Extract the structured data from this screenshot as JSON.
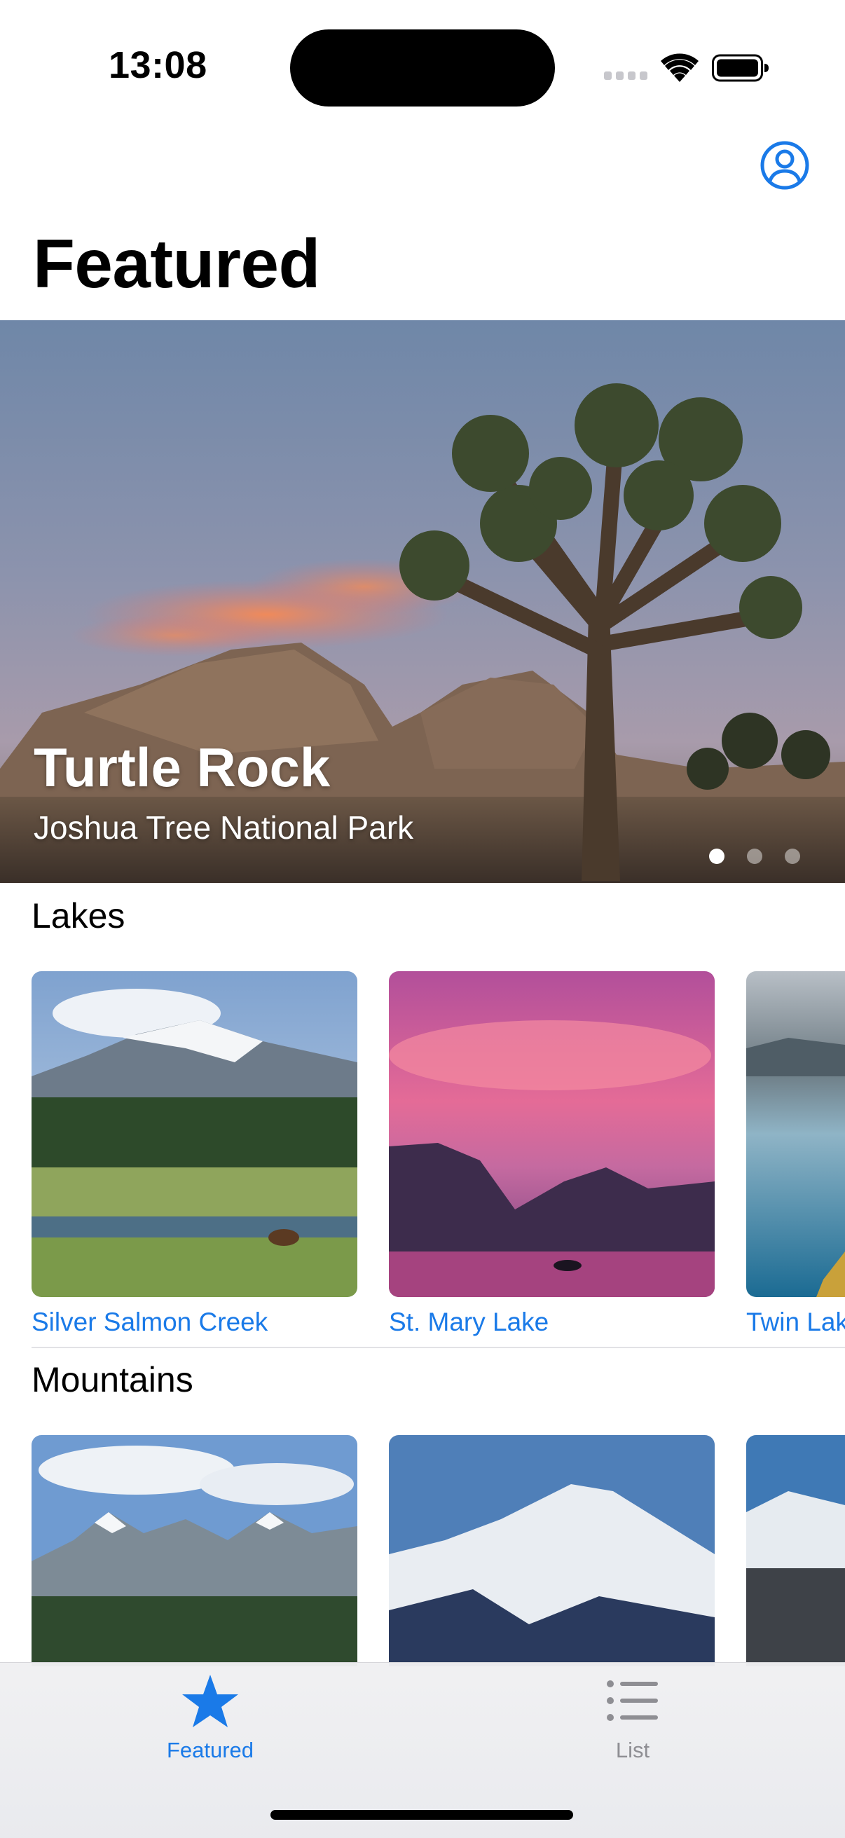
{
  "status_bar": {
    "time": "13:08"
  },
  "header": {
    "title": "Featured",
    "profile_icon": "person-circle-icon"
  },
  "hero": {
    "title": "Turtle Rock",
    "subtitle": "Joshua Tree National Park",
    "page_count": 3,
    "current_page": 1
  },
  "sections": [
    {
      "title": "Lakes",
      "items": [
        {
          "name": "Silver Salmon Creek"
        },
        {
          "name": "St. Mary Lake"
        },
        {
          "name": "Twin Lak"
        }
      ]
    },
    {
      "title": "Mountains",
      "items": []
    }
  ],
  "tab_bar": {
    "tabs": [
      {
        "label": "Featured",
        "icon": "star-icon",
        "selected": true
      },
      {
        "label": "List",
        "icon": "list-icon",
        "selected": false
      }
    ]
  },
  "colors": {
    "accent": "#1a7ae8",
    "inactive": "#8e8e93"
  }
}
